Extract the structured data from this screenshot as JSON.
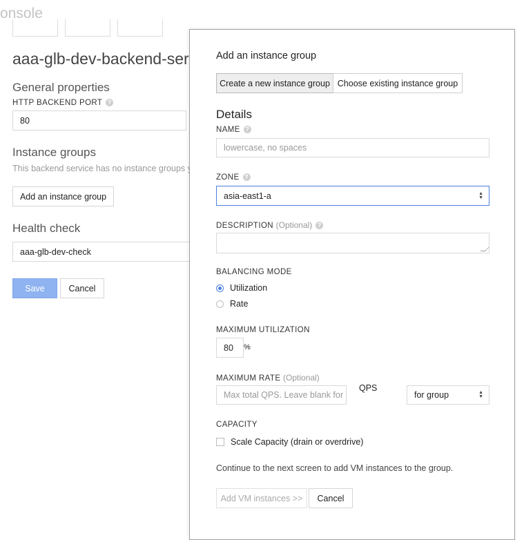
{
  "app": {
    "title": "onsole"
  },
  "service": {
    "title": "aaa-glb-dev-backend-servic",
    "general_heading": "General properties",
    "port_label": "HTTP BACKEND PORT",
    "port_value": "80",
    "instance_groups_heading": "Instance groups",
    "no_groups_text": "This backend service has no instance groups yet",
    "add_group_label": "Add an instance group",
    "health_heading": "Health check",
    "health_value": "aaa-glb-dev-check",
    "save_label": "Save",
    "cancel_label": "Cancel"
  },
  "dialog": {
    "title": "Add an instance group",
    "mode_tabs": [
      {
        "label": "Create a new instance group",
        "active": true
      },
      {
        "label": "Choose existing instance group",
        "active": false
      }
    ],
    "details_heading": "Details",
    "name_label": "NAME",
    "name_placeholder": "lowercase, no spaces",
    "zone_label": "ZONE",
    "zone_value": "asia-east1-a",
    "description_label": "DESCRIPTION",
    "optional": "(Optional)",
    "balancing_label": "BALANCING MODE",
    "balancing_options": [
      {
        "label": "Utilization",
        "selected": true
      },
      {
        "label": "Rate",
        "selected": false
      }
    ],
    "max_util_label": "MAXIMUM UTILIZATION",
    "max_util_value": "80",
    "percent": "%",
    "max_rate_label": "MAXIMUM RATE",
    "max_rate_placeholder": "Max total QPS. Leave blank for",
    "qps": "QPS",
    "rate_scope_value": "for group",
    "capacity_label": "CAPACITY",
    "scale_capacity_label": "Scale Capacity (drain or overdrive)",
    "continue_text": "Continue to the next screen to add VM instances to the group.",
    "add_vm_label": "Add VM instances >>",
    "cancel_label": "Cancel"
  },
  "icons": {
    "help": "help-icon",
    "select": "select-arrows-icon",
    "resize": "resize-handle-icon"
  },
  "colors": {
    "primary": "#8fb3f0",
    "radio_on": "#4a7fe0",
    "focus_border": "#4a7fe0"
  }
}
